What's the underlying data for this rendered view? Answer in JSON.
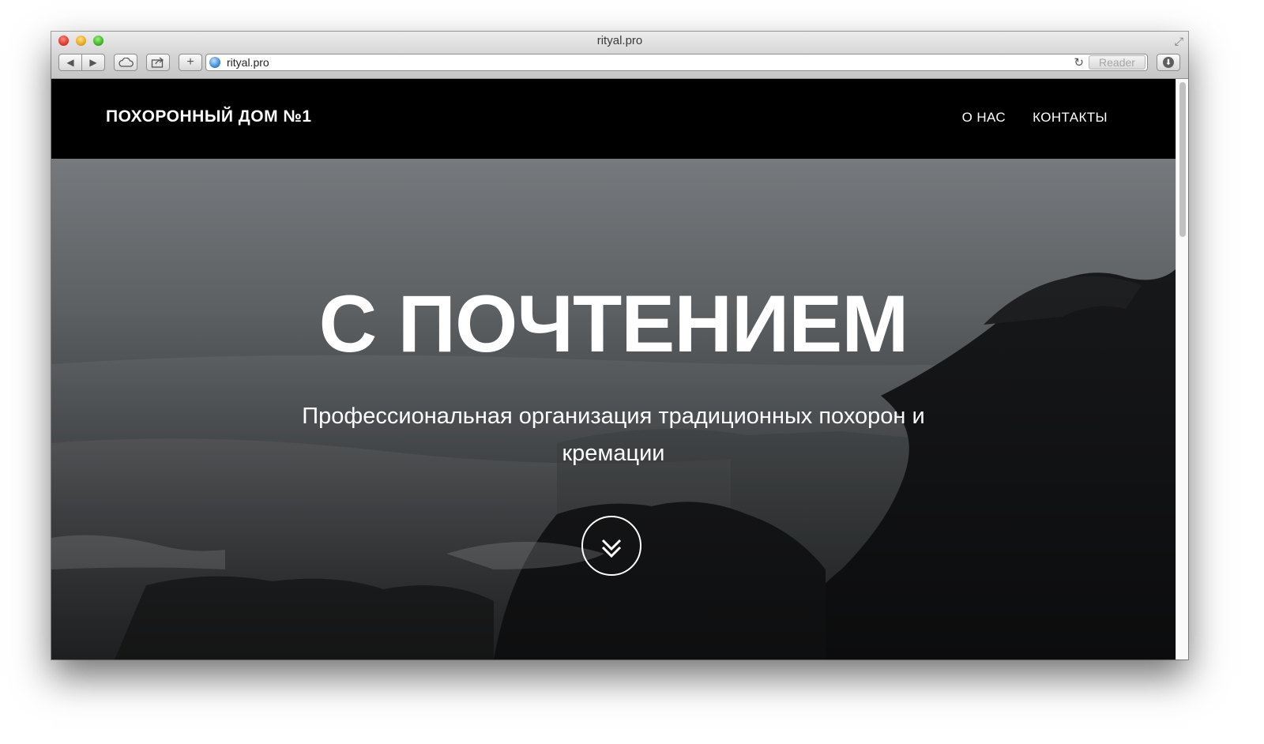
{
  "browser": {
    "window_title": "rityal.pro",
    "address": "rityal.pro",
    "reader_label": "Reader",
    "icons": {
      "back": "back-arrow-icon",
      "forward": "forward-arrow-icon",
      "icloud": "cloud-icon",
      "share": "share-icon",
      "new_tab": "plus-icon",
      "reload": "reload-icon",
      "download": "download-icon",
      "fullscreen": "fullscreen-icon"
    }
  },
  "site": {
    "logo": "ПОХОРОННЫЙ ДОМ №1",
    "nav": [
      {
        "label": "О НАС"
      },
      {
        "label": "КОНТАКТЫ"
      }
    ],
    "hero": {
      "headline": "С ПОЧТЕНИЕМ",
      "subheadline": "Профессиональная организация традиционных похорон и кремации",
      "scroll_icon": "double-chevron-down-icon"
    }
  },
  "colors": {
    "header_bg": "#000000",
    "text": "#ffffff"
  }
}
